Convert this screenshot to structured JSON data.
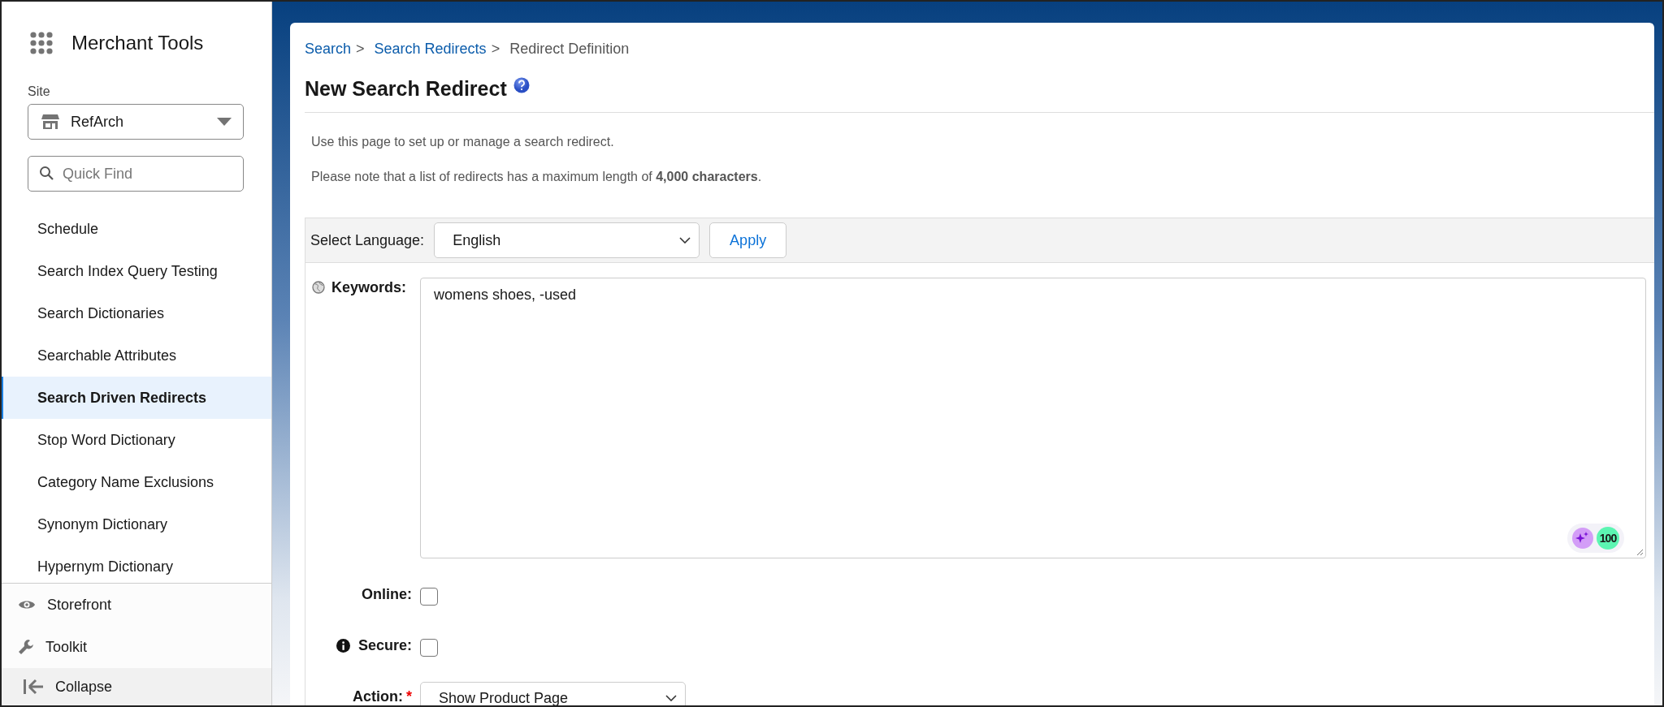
{
  "app": {
    "title": "Merchant Tools"
  },
  "site": {
    "label": "Site",
    "value": "RefArch"
  },
  "quick_find": {
    "placeholder": "Quick Find"
  },
  "nav_items": [
    {
      "label": "Schedule",
      "selected": false
    },
    {
      "label": "Search Index Query Testing",
      "selected": false
    },
    {
      "label": "Search Dictionaries",
      "selected": false
    },
    {
      "label": "Searchable Attributes",
      "selected": false
    },
    {
      "label": "Search Driven Redirects",
      "selected": true
    },
    {
      "label": "Stop Word Dictionary",
      "selected": false
    },
    {
      "label": "Category Name Exclusions",
      "selected": false
    },
    {
      "label": "Synonym Dictionary",
      "selected": false
    },
    {
      "label": "Hypernym Dictionary",
      "selected": false
    }
  ],
  "bottom_nav": [
    {
      "label": "Storefront",
      "kind": "eye"
    },
    {
      "label": "Toolkit",
      "kind": "wrench"
    },
    {
      "label": "Collapse",
      "kind": "collapse"
    }
  ],
  "breadcrumb": [
    {
      "label": "Search",
      "link": true
    },
    {
      "label": "Search Redirects",
      "link": true
    },
    {
      "label": "Redirect Definition",
      "link": false
    }
  ],
  "separator": ">",
  "page_title": "New Search Redirect",
  "intro": [
    "Use this page to set up or manage a search redirect.",
    "Please note that a list of redirects has a maximum length of **4,000 characters**."
  ],
  "language": {
    "label": "Select Language:",
    "value": "English",
    "button": "Apply"
  },
  "keywords": {
    "label": "Keywords:",
    "value": "womens shoes, -used",
    "score": "100"
  },
  "online": {
    "label": "Online:",
    "checked": false
  },
  "secure": {
    "label": "Secure:",
    "checked": false
  },
  "action": {
    "label": "Action:",
    "required": "*",
    "value": "Show Product Page"
  }
}
